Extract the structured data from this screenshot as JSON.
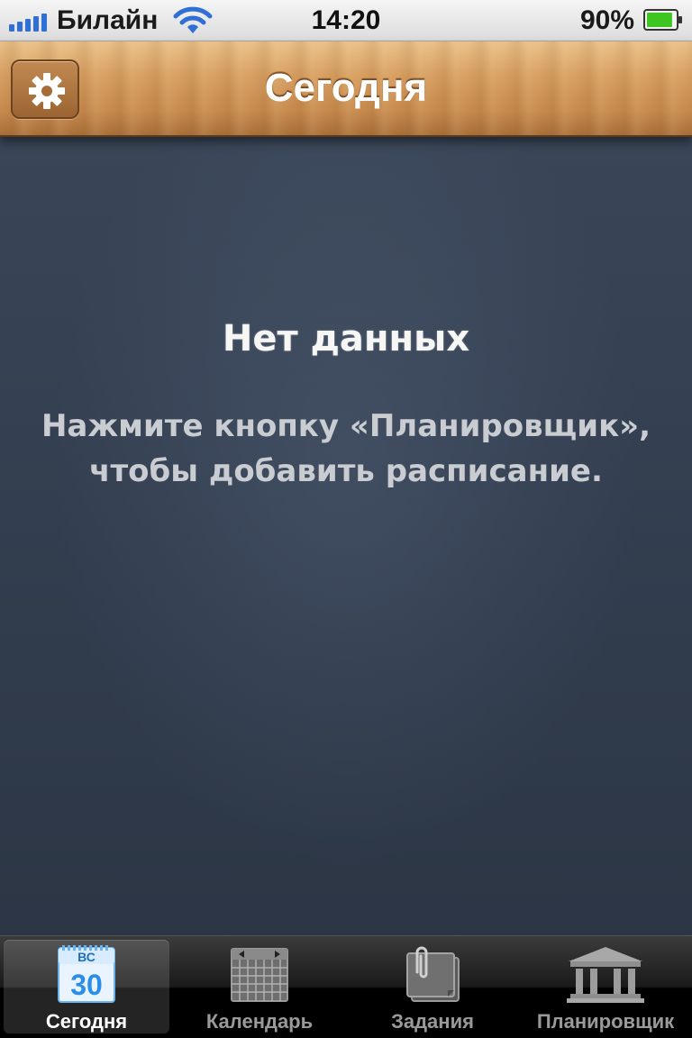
{
  "status_bar": {
    "carrier": "Билайн",
    "time": "14:20",
    "battery_percent": "90%",
    "signal_bars": 5,
    "battery_level": 0.9
  },
  "nav_bar": {
    "title": "Сегодня",
    "settings_icon": "gear-icon"
  },
  "empty_state": {
    "title": "Нет данных",
    "message_line1": "Нажмите кнопку «Планировщик»,",
    "message_line2": "чтобы добавить расписание."
  },
  "tab_bar": {
    "tabs": [
      {
        "label": "Сегодня",
        "icon": "today-calendar-icon",
        "selected": true,
        "day_abbr": "ВС",
        "day_number": "30"
      },
      {
        "label": "Календарь",
        "icon": "calendar-grid-icon",
        "selected": false
      },
      {
        "label": "Задания",
        "icon": "notes-clip-icon",
        "selected": false
      },
      {
        "label": "Планировщик",
        "icon": "building-columns-icon",
        "selected": false
      }
    ]
  },
  "colors": {
    "accent_blue": "#2f6fd6",
    "board": "#313c4d",
    "wood": "#d8a062",
    "battery_green": "#3ec521"
  }
}
